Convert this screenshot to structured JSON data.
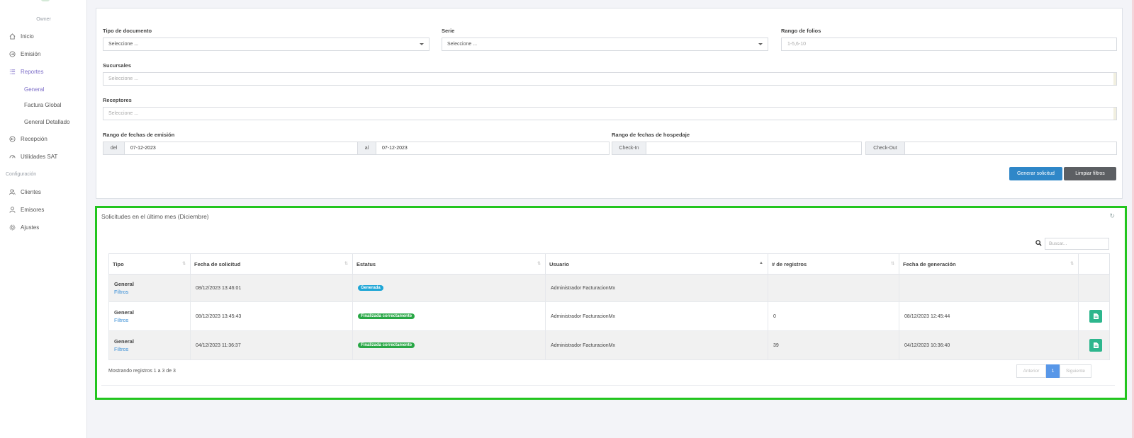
{
  "sidebar": {
    "role": "Owner",
    "items": {
      "inicio": "Inicio",
      "emision": "Emisión",
      "reportes": "Reportes",
      "recepcion": "Recepción",
      "utilidades": "Utilidades SAT",
      "clientes": "Clientes",
      "emisores": "Emisores",
      "ajustes": "Ajustes"
    },
    "sub": {
      "general": "General",
      "factura_global": "Factura Global",
      "general_detallado": "General Detallado"
    },
    "config_label": "Configuración"
  },
  "filters": {
    "tipo_label": "Tipo de documento",
    "tipo_value": "Seleccione ...",
    "serie_label": "Serie",
    "serie_value": "Seleccione ...",
    "folios_label": "Rango de folios",
    "folios_placeholder": "1-5,6-10",
    "sucursales_label": "Sucursales",
    "sucursales_value": "Seleccione ...",
    "receptores_label": "Receptores",
    "receptores_value": "Seleccione ...",
    "emision_label": "Rango de fechas de emisión",
    "del_label": "del",
    "del_value": "07-12-2023",
    "al_label": "al",
    "al_value": "07-12-2023",
    "hospedaje_label": "Rango de fechas de hospedaje",
    "checkin_label": "Check-In",
    "checkout_label": "Check-Out",
    "generar_btn": "Generar solicitud",
    "limpiar_btn": "Limpiar filtros"
  },
  "requests": {
    "title": "Solicitudes en el último mes (Diciembre)",
    "search_placeholder": "Buscar...",
    "columns": [
      "Tipo",
      "Fecha de solicitud",
      "Estatus",
      "Usuario",
      "# de registros",
      "Fecha de generación"
    ],
    "rows": [
      {
        "tipo": "General",
        "link": "Filtros",
        "fecha": "08/12/2023 13:46:01",
        "estatus": "Generada",
        "usuario": "Administrador FacturacionMx",
        "registros": "",
        "generacion": ""
      },
      {
        "tipo": "General",
        "link": "Filtros",
        "fecha": "08/12/2023 13:45:43",
        "estatus": "Finalizada correctamente",
        "usuario": "Administrador FacturacionMx",
        "registros": "0",
        "generacion": "08/12/2023 12:45:44"
      },
      {
        "tipo": "General",
        "link": "Filtros",
        "fecha": "04/12/2023 11:36:37",
        "estatus": "Finalizada correctamente",
        "usuario": "Administrador FacturacionMx",
        "registros": "39",
        "generacion": "04/12/2023 10:36:40"
      }
    ],
    "footer": "Mostrando registros 1 a 3 de 3",
    "pager": {
      "prev": "Anterior",
      "page": "1",
      "next": "Siguiente"
    }
  },
  "colors": {
    "accent": "#7d6ec8",
    "primary_button": "#2f87c8",
    "highlight_border": "#22c51e",
    "badge_generada": "#1fa6d6",
    "badge_finalizada": "#28a745"
  }
}
